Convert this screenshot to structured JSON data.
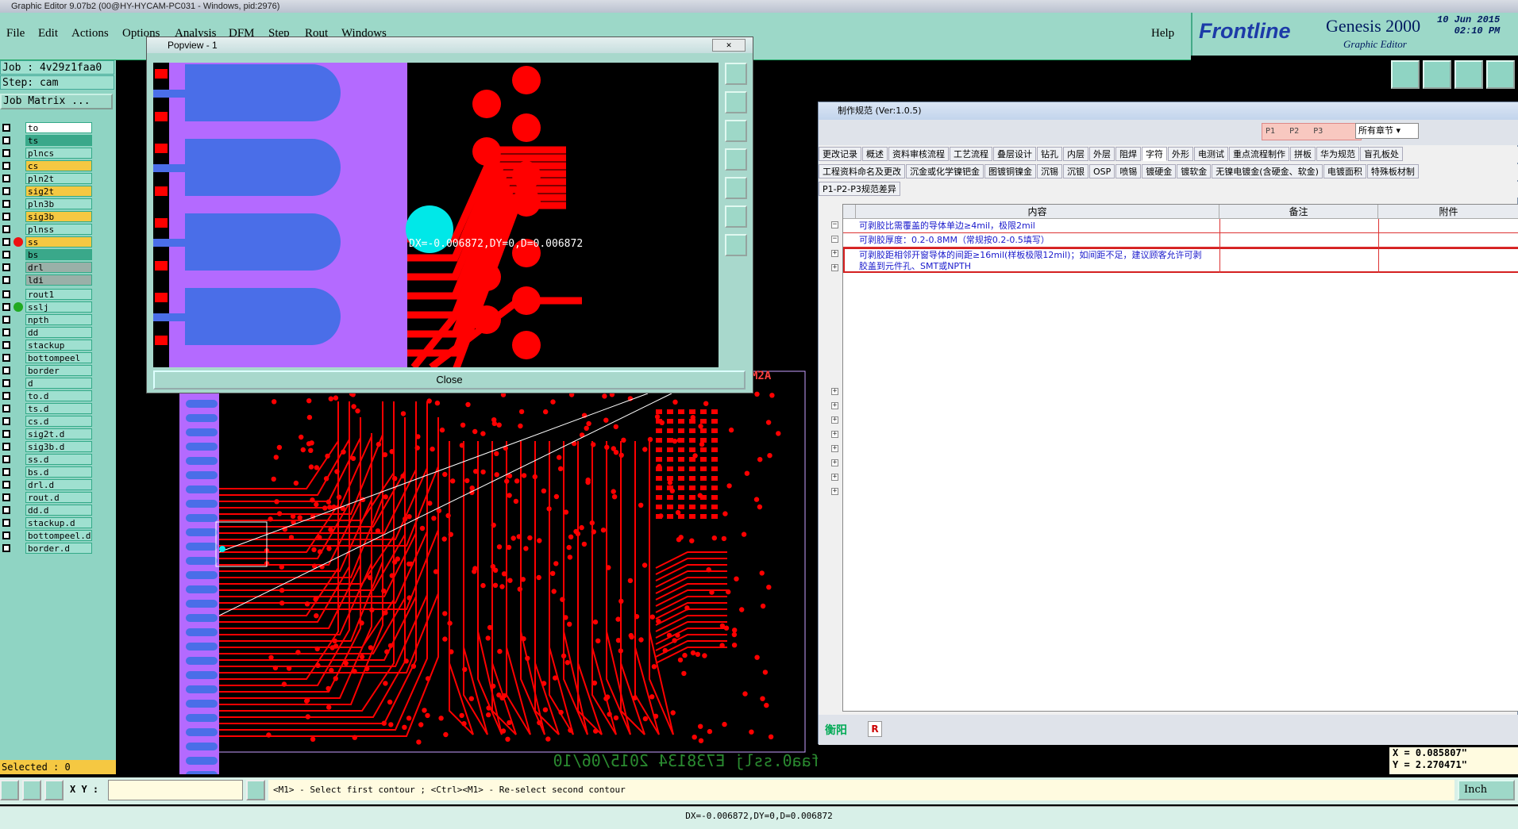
{
  "window": {
    "title": "Graphic Editor 9.07b2 (00@HY-HYCAM-PC031 - Windows, pid:2976)"
  },
  "menu": {
    "items": [
      "File",
      "Edit",
      "Actions",
      "Options",
      "Analysis",
      "DFM",
      "Step",
      "Rout",
      "Windows"
    ],
    "help": "Help"
  },
  "brand": {
    "logo": "Frontline",
    "product": "Genesis 2000",
    "subtitle": "Graphic Editor",
    "date": "10 Jun 2015",
    "time": "02:10 PM"
  },
  "job": {
    "job_line": "Job : 4v29z1faa0",
    "step_line": "Step: cam",
    "matrix_button": "Job Matrix ..."
  },
  "layers": [
    {
      "name": "to",
      "color": "#ffffff",
      "dot": ""
    },
    {
      "name": "ts",
      "color": "#3aa88a",
      "dot": ""
    },
    {
      "name": "plncs",
      "color": "#9fe0d0",
      "dot": ""
    },
    {
      "name": "cs",
      "color": "#f5c842",
      "dot": ""
    },
    {
      "name": "pln2t",
      "color": "#9fe0d0",
      "dot": ""
    },
    {
      "name": "sig2t",
      "color": "#f5c842",
      "dot": ""
    },
    {
      "name": "pln3b",
      "color": "#9fe0d0",
      "dot": ""
    },
    {
      "name": "sig3b",
      "color": "#f5c842",
      "dot": ""
    },
    {
      "name": "plnss",
      "color": "#9fe0d0",
      "dot": ""
    },
    {
      "name": "ss",
      "color": "#f5c842",
      "dot": "#ee1111"
    },
    {
      "name": "bs",
      "color": "#3aa88a",
      "dot": ""
    },
    {
      "name": "drl",
      "color": "#9ab0a8",
      "dot": ""
    },
    {
      "name": "ldi",
      "color": "#9ab0a8",
      "dot": ""
    },
    {
      "name": "rout1",
      "color": "#9fe0d0",
      "dot": ""
    },
    {
      "name": "sslj",
      "color": "#9fe0d0",
      "dot": "#22aa22"
    },
    {
      "name": "npth",
      "color": "#9fe0d0",
      "dot": ""
    },
    {
      "name": "dd",
      "color": "#9fe0d0",
      "dot": ""
    },
    {
      "name": "stackup",
      "color": "#9fe0d0",
      "dot": ""
    },
    {
      "name": "bottompeel",
      "color": "#9fe0d0",
      "dot": ""
    },
    {
      "name": "border",
      "color": "#9fe0d0",
      "dot": ""
    },
    {
      "name": "d",
      "color": "#9fe0d0",
      "dot": ""
    },
    {
      "name": "to.d",
      "color": "#9fe0d0",
      "dot": ""
    },
    {
      "name": "ts.d",
      "color": "#9fe0d0",
      "dot": ""
    },
    {
      "name": "cs.d",
      "color": "#9fe0d0",
      "dot": ""
    },
    {
      "name": "sig2t.d",
      "color": "#9fe0d0",
      "dot": ""
    },
    {
      "name": "sig3b.d",
      "color": "#9fe0d0",
      "dot": ""
    },
    {
      "name": "ss.d",
      "color": "#9fe0d0",
      "dot": ""
    },
    {
      "name": "bs.d",
      "color": "#9fe0d0",
      "dot": ""
    },
    {
      "name": "drl.d",
      "color": "#9fe0d0",
      "dot": ""
    },
    {
      "name": "rout.d",
      "color": "#9fe0d0",
      "dot": ""
    },
    {
      "name": "dd.d",
      "color": "#9fe0d0",
      "dot": ""
    },
    {
      "name": "stackup.d",
      "color": "#9fe0d0",
      "dot": ""
    },
    {
      "name": "bottompeel.d",
      "color": "#9fe0d0",
      "dot": ""
    },
    {
      "name": "border.d",
      "color": "#9fe0d0",
      "dot": ""
    }
  ],
  "selected": "Selected : 0",
  "popview": {
    "title": "Popview - 1",
    "close_label": "Close",
    "measure_label": "DX=-0.006872,DY=0,D=0.006872"
  },
  "pcb": {
    "board_label": "M2A",
    "mirror_text": "4v29z1faa0.sslj E738134 2015/06/10"
  },
  "spec": {
    "title": "制作规范 (Ver:1.0.5)",
    "filters": [
      "P1",
      "P2",
      "P3"
    ],
    "chapter_select": "所有章节",
    "tabs_row1": [
      "更改记录",
      "概述",
      "资料审核流程",
      "工艺流程",
      "叠层设计",
      "钻孔",
      "内层",
      "外层",
      "阻焊",
      "字符",
      "外形",
      "电测试",
      "重点流程制作",
      "拼板",
      "华为规范",
      "盲孔板处"
    ],
    "active_tab": "字符",
    "tabs_row2": [
      "工程资料命名及更改",
      "沉金或化学镍钯金",
      "图镀铜镍金",
      "沉锡",
      "沉银",
      "OSP",
      "喷锡",
      "镀硬金",
      "镀软金",
      "无镍电镀金(含硬金、软金)",
      "电镀面积",
      "特殊板材制"
    ],
    "tabs_row3": [
      "P1-P2-P3规范差异"
    ],
    "columns": [
      "内容",
      "备注",
      "附件"
    ],
    "rows": [
      "可剥胶比需覆盖的导体单边≥4mil，极限2mil",
      "可剥胶厚度：0.2-0.8MM（常规按0.2-0.5填写）",
      "可剥胶距相邻开窗导体的间距≥16mil(样板极限12mil)；如间距不足，建议顾客允许可剥胶盖到元件孔、SMT或NPTH"
    ],
    "footer_label": "衡阳",
    "footer_badge": "R"
  },
  "status": {
    "xy_label": "X Y :",
    "xy_value": "",
    "prompt": "<M1> - Select first contour ; <Ctrl><M1> - Re-select second contour",
    "unit": "Inch",
    "coord_x": "X = 0.085807\"",
    "coord_y": "Y = 2.270471\"",
    "measure": "DX=-0.006872,DY=0,D=0.006872"
  },
  "colors": {
    "copper": "#ff0000",
    "finger": "#4a6ee8",
    "mask": "#b46aff",
    "panel": "#8fd4c3",
    "highlight": "#d42020"
  }
}
